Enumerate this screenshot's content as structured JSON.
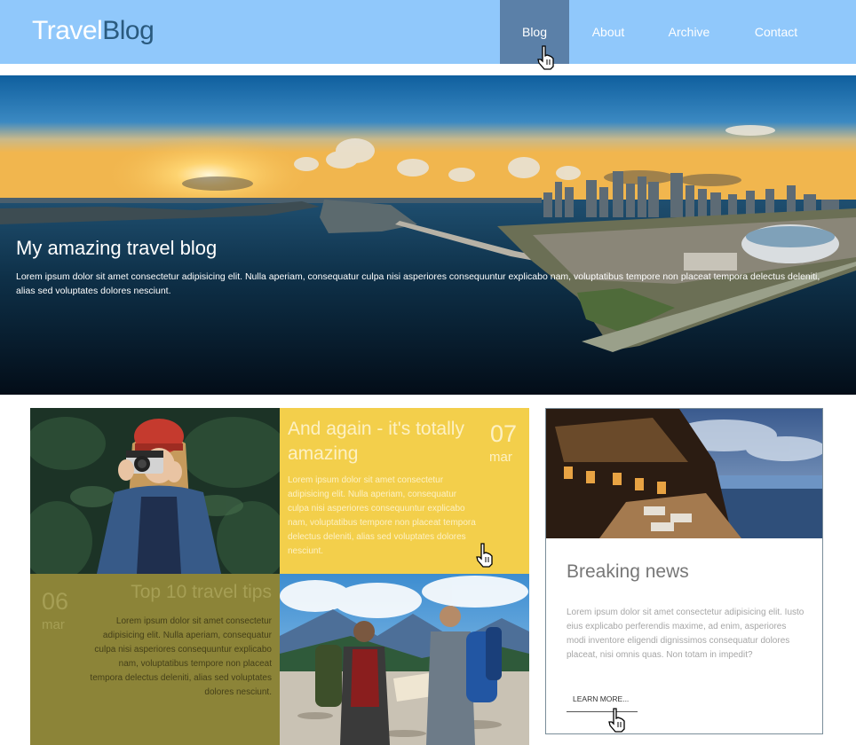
{
  "header": {
    "logo_part1": "Travel",
    "logo_part2": "Blog",
    "nav": [
      "Blog",
      "About",
      "Archive",
      "Contact"
    ],
    "active_nav": "Blog"
  },
  "hero": {
    "title": "My amazing travel blog",
    "text": "Lorem ipsum dolor sit amet consectetur adipisicing elit. Nulla aperiam, consequatur culpa nisi asperiores consequuntur explicabo nam, voluptatibus tempore non placeat tempora delectus deleniti, alias sed voluptates dolores nesciunt."
  },
  "posts": [
    {
      "title": "And again - it's totally amazing",
      "day": "07",
      "month": "mar",
      "text": "Lorem ipsum dolor sit amet consectetur adipisicing elit. Nulla aperiam, consequatur culpa nisi asperiores consequuntur explicabo nam, voluptatibus tempore non placeat tempora delectus deleniti, alias sed voluptates dolores nesciunt."
    },
    {
      "title": "Top 10 travel tips",
      "day": "06",
      "month": "mar",
      "text": "Lorem ipsum dolor sit amet consectetur adipisicing elit. Nulla aperiam, consequatur culpa nisi asperiores consequuntur explicabo nam, voluptatibus tempore non placeat tempora delectus deleniti, alias sed voluptates dolores nesciunt."
    }
  ],
  "news": {
    "title": "Breaking news",
    "text": "Lorem ipsum dolor sit amet consectetur adipisicing elit. Iusto eius explicabo perferendis maxime, ad enim, asperiores modi inventore eligendi dignissimos consequatur dolores placeat, nisi omnis quas. Non totam in impedit?",
    "button": "LEARN MORE..."
  },
  "colors": {
    "header": "#90c8fb",
    "nav_active": "#5b80a8",
    "yellow_tile": "#f3cf4b",
    "olive_tile": "#8c8438"
  },
  "icons": [
    "hand-pointer-cursor-icon"
  ]
}
